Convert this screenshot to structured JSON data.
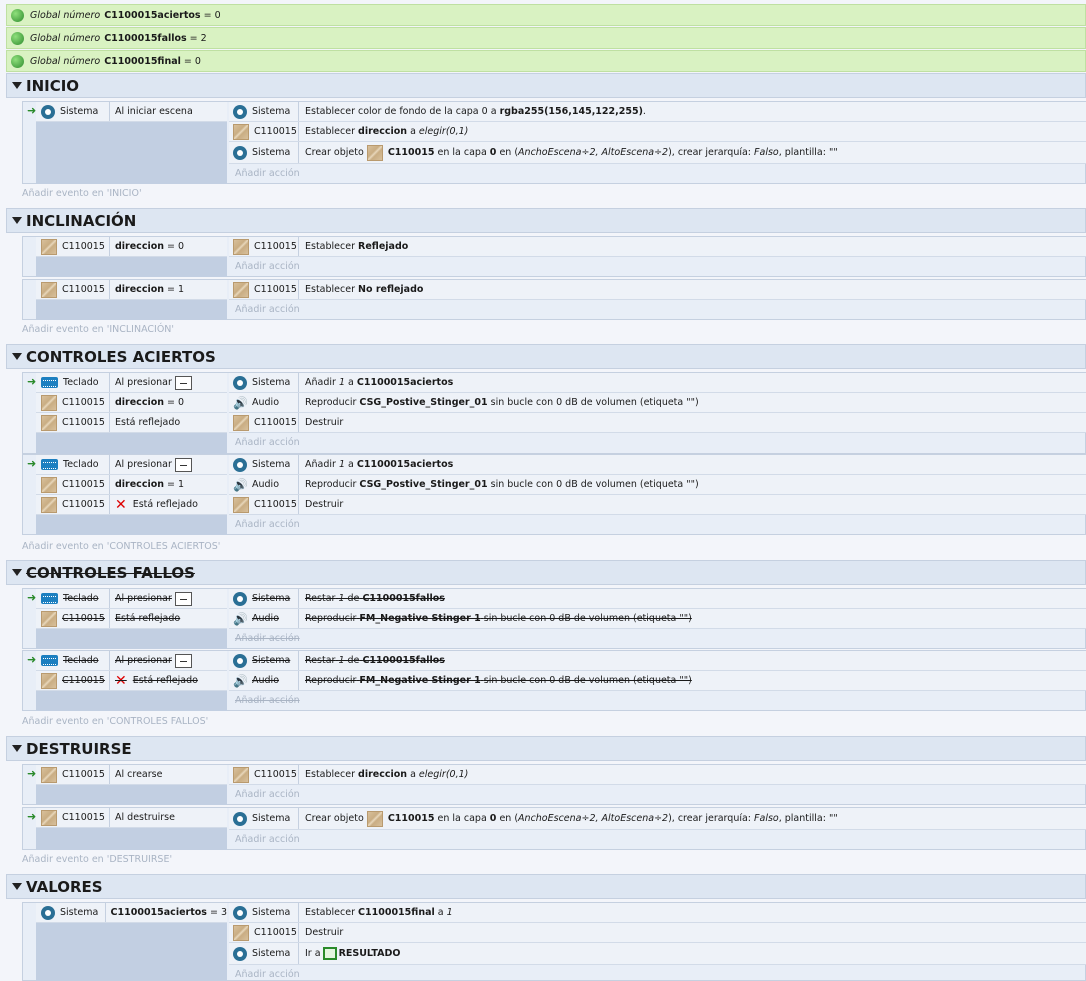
{
  "globals": [
    {
      "prefix": "Global número",
      "name": "C1100015aciertos",
      "value": "= 0"
    },
    {
      "prefix": "Global número",
      "name": "C1100015fallos",
      "value": "= 2"
    },
    {
      "prefix": "Global número",
      "name": "C1100015final",
      "value": "= 0"
    }
  ],
  "common": {
    "add_action": "Añadir acción",
    "sistema": "Sistema",
    "obj": "C110015",
    "teclado": "Teclado",
    "audio": "Audio"
  },
  "inicio": {
    "title": "INICIO",
    "add_event": "Añadir evento en 'INICIO'",
    "cond": "Al iniciar escena",
    "a1": "Establecer color de fondo de la capa 0 a",
    "a1b": "rgba255(156,145,122,255)",
    "a1c": ".",
    "a2": "Establecer",
    "a2b": "direccion",
    "a2c": "a",
    "a2d": "elegir(0,1)",
    "a3": "Crear objeto",
    "a3b": "C110015",
    "a3c": "en la capa",
    "a3d": "0",
    "a3e": "en (",
    "a3f": "AnchoEscena÷2, AltoEscena÷2",
    "a3g": "), crear jerarquía:",
    "a3h": "Falso",
    "a3i": ", plantilla: \"\""
  },
  "inclinacion": {
    "title": "INCLINACIÓN",
    "add_event": "Añadir evento en 'INCLINACIÓN'",
    "e1c": "direccion",
    "e1v": "= 0",
    "e1a": "Establecer",
    "e1ab": "Reflejado",
    "e2c": "direccion",
    "e2v": "= 1",
    "e2a": "Establecer",
    "e2ab": "No reflejado"
  },
  "aciertos": {
    "title": "CONTROLES ACIERTOS",
    "add_event": "Añadir evento en 'CONTROLES ACIERTOS'",
    "al_presionar": "Al presionar",
    "dir": "direccion",
    "dir_v": "= 0",
    "dir_v1": "= 1",
    "refl": "Está reflejado",
    "add1": "Añadir",
    "add1n": "1",
    "add1c": "a",
    "add1v": "C1100015aciertos",
    "snd": "Reproducir",
    "sndn": "CSG_Postive_Stinger_01",
    "sndr": "sin bucle con 0 dB de volumen (etiqueta \"\")",
    "destroy": "Destruir"
  },
  "fallos": {
    "title": "CONTROLES FALLOS",
    "add_event": "Añadir evento en 'CONTROLES FALLOS'",
    "al_presionar": "Al presionar",
    "refl": "Está reflejado",
    "sub": "Restar",
    "subn": "1",
    "subc": "de",
    "subv": "C1100015fallos",
    "snd": "Reproducir",
    "sndn": "FM_Negative Stinger 1",
    "sndr": "sin bucle con 0 dB de volumen (etiqueta \"\")"
  },
  "destruirse": {
    "title": "DESTRUIRSE",
    "add_event": "Añadir evento en 'DESTRUIRSE'",
    "c1": "Al crearse",
    "a1": "Establecer",
    "a1b": "direccion",
    "a1c": "a",
    "a1d": "elegir(0,1)",
    "c2": "Al destruirse",
    "a2": "Crear objeto",
    "a2b": "C110015",
    "a2c": "en la capa",
    "a2d": "0",
    "a2e": "en (",
    "a2f": "AnchoEscena÷2, AltoEscena÷2",
    "a2g": "), crear jerarquía:",
    "a2h": "Falso",
    "a2i": ", plantilla: \"\""
  },
  "valores": {
    "title": "VALORES",
    "cond": "C1100015aciertos",
    "cond_v": "= 3",
    "a1": "Establecer",
    "a1b": "C1100015final",
    "a1c": "a",
    "a1d": "1",
    "a2": "Destruir",
    "a3": "Ir a",
    "a3b": "RESULTADO"
  }
}
